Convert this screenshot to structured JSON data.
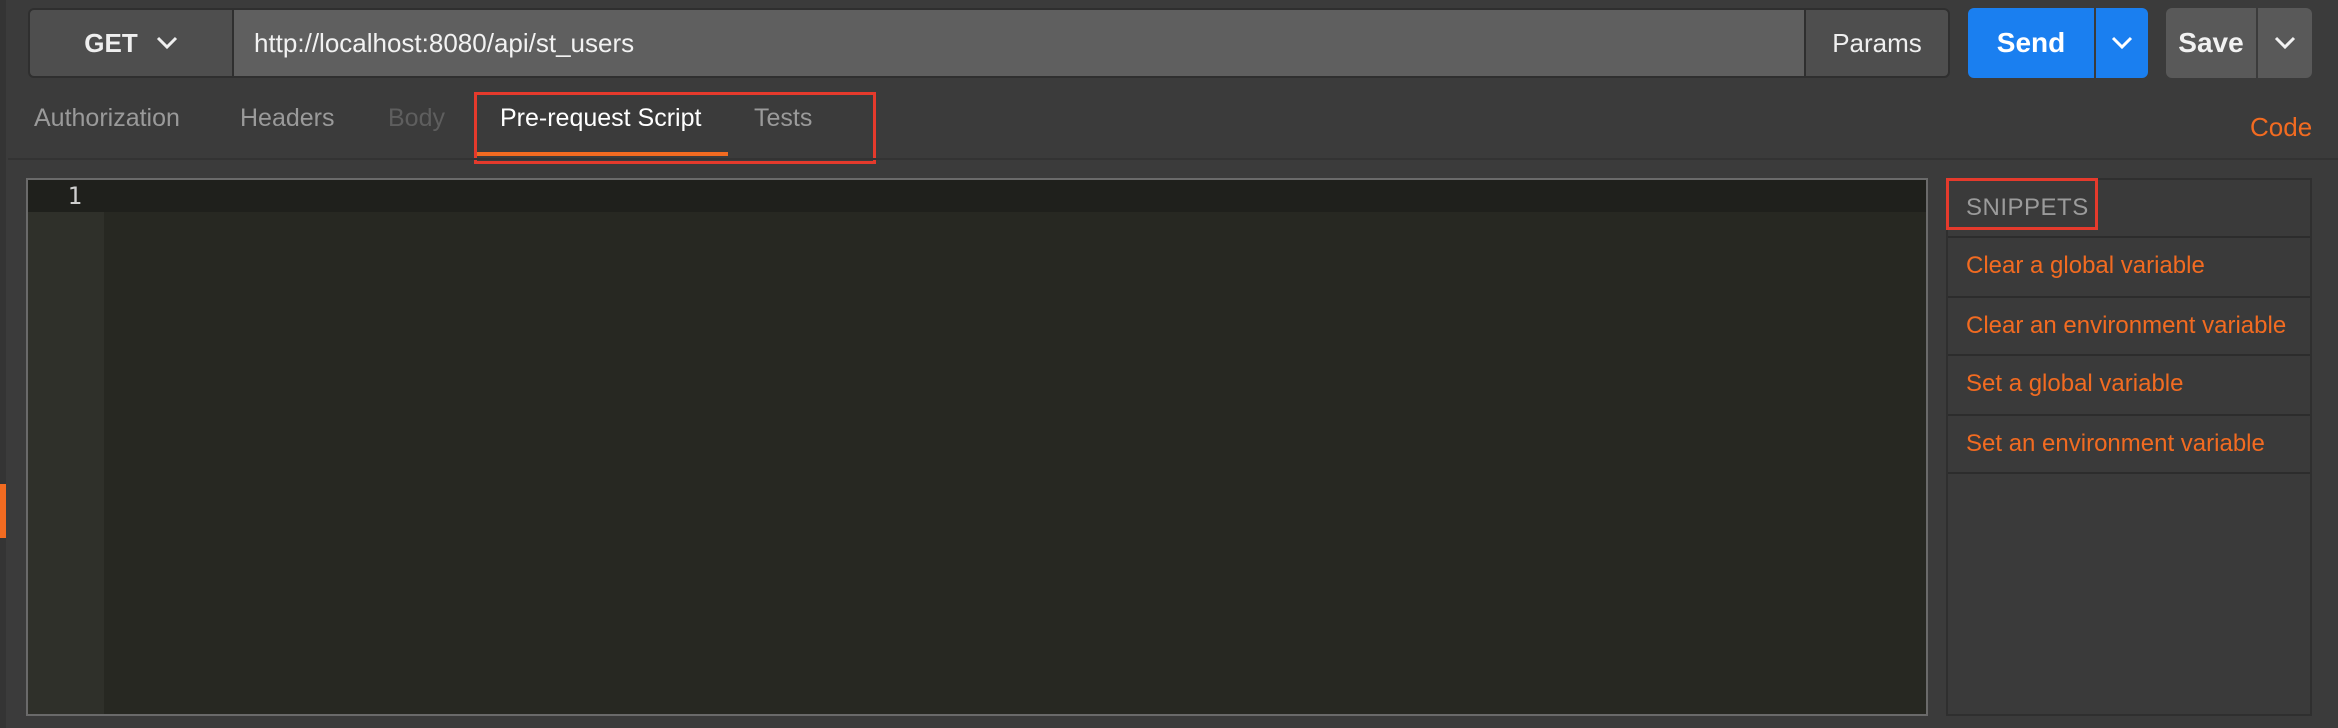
{
  "request": {
    "method": "GET",
    "url": "http://localhost:8080/api/st_users",
    "params_label": "Params",
    "send_label": "Send",
    "save_label": "Save"
  },
  "tabs": [
    {
      "label": "Authorization",
      "state": "normal"
    },
    {
      "label": "Headers",
      "state": "normal"
    },
    {
      "label": "Body",
      "state": "disabled"
    },
    {
      "label": "Pre-request Script",
      "state": "active"
    },
    {
      "label": "Tests",
      "state": "normal"
    }
  ],
  "code_link": "Code",
  "editor": {
    "line_numbers": [
      "1"
    ],
    "content": ""
  },
  "snippets": {
    "title": "SNIPPETS",
    "items": [
      "Clear a global variable",
      "Clear an environment variable",
      "Set a global variable",
      "Set an environment variable"
    ]
  },
  "icons": {
    "method_dropdown": "chevron-down-icon",
    "send_dropdown": "chevron-down-icon",
    "save_dropdown": "chevron-down-icon"
  },
  "colors": {
    "accent_orange": "#f26b21",
    "send_blue": "#1a7ff0",
    "highlight_red": "#e53a2c",
    "editor_bg": "#272822"
  }
}
